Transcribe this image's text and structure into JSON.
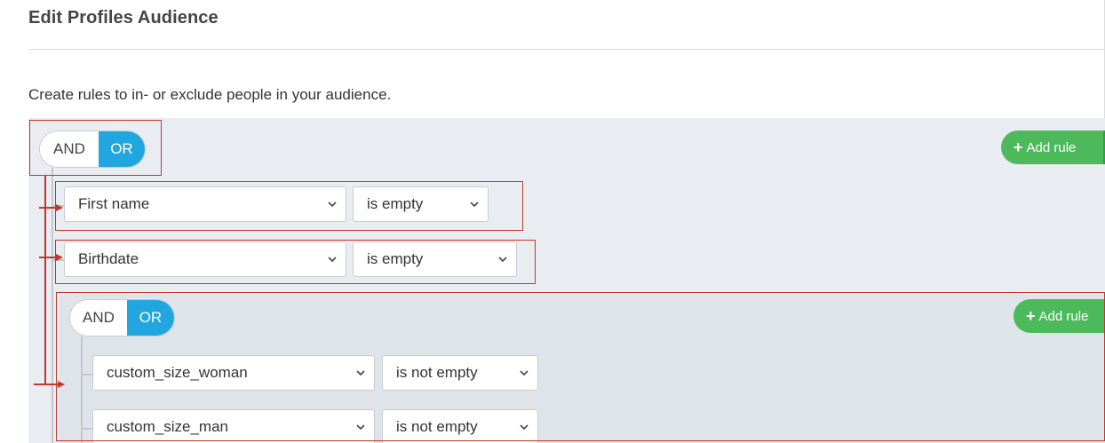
{
  "header": {
    "title": "Edit Profiles Audience"
  },
  "intro": {
    "text": "Create rules to in- or exclude people in your audience."
  },
  "outer_group": {
    "toggle": {
      "and_label": "AND",
      "or_label": "OR",
      "selected": "OR"
    },
    "add_rule_label": "Add rule",
    "rules": [
      {
        "field": "First name",
        "operator": "is empty"
      },
      {
        "field": "Birthdate",
        "operator": "is empty"
      }
    ]
  },
  "nested_group": {
    "toggle": {
      "and_label": "AND",
      "or_label": "OR",
      "selected": "OR"
    },
    "add_rule_label": "Add rule",
    "rules": [
      {
        "field": "custom_size_woman",
        "operator": "is not empty"
      },
      {
        "field": "custom_size_man",
        "operator": "is not empty"
      }
    ]
  },
  "colors": {
    "accent_blue": "#22a6e0",
    "add_green": "#4cba5b",
    "annotation_red": "#c0392b"
  },
  "icons": [
    "plus-icon",
    "chevron-down-icon"
  ]
}
